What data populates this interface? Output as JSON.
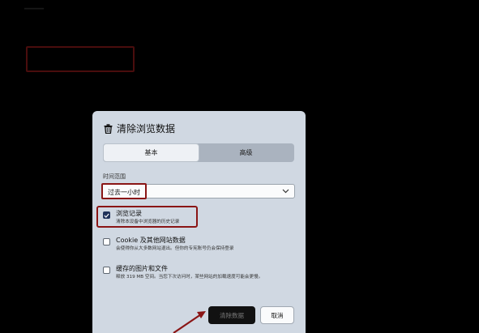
{
  "dialog": {
    "title": "清除浏览数据",
    "tabs": [
      {
        "label": "基本",
        "active": true
      },
      {
        "label": "高级",
        "active": false
      }
    ],
    "time_range": {
      "label": "时间范围",
      "value": "过去一小时"
    },
    "options": [
      {
        "title": "浏览记录",
        "description": "清除本设备中浏览器的历史记录",
        "checked": true
      },
      {
        "title": "Cookie 及其他网站数据",
        "description": "会使得你从大多数网站退出。但你的专宪账号仍会保持登录",
        "checked": false
      },
      {
        "title": "缓存的图片和文件",
        "description": "释放 319 MB 空间。当您下次访问时，某些网站的加载速度可能会更慢。",
        "checked": false
      }
    ],
    "buttons": {
      "clear": "清除数据",
      "cancel": "取消"
    }
  },
  "colors": {
    "highlight": "#8a1515",
    "checkbox_checked": "#20325a",
    "dialog_bg": "#d0d8e2"
  }
}
